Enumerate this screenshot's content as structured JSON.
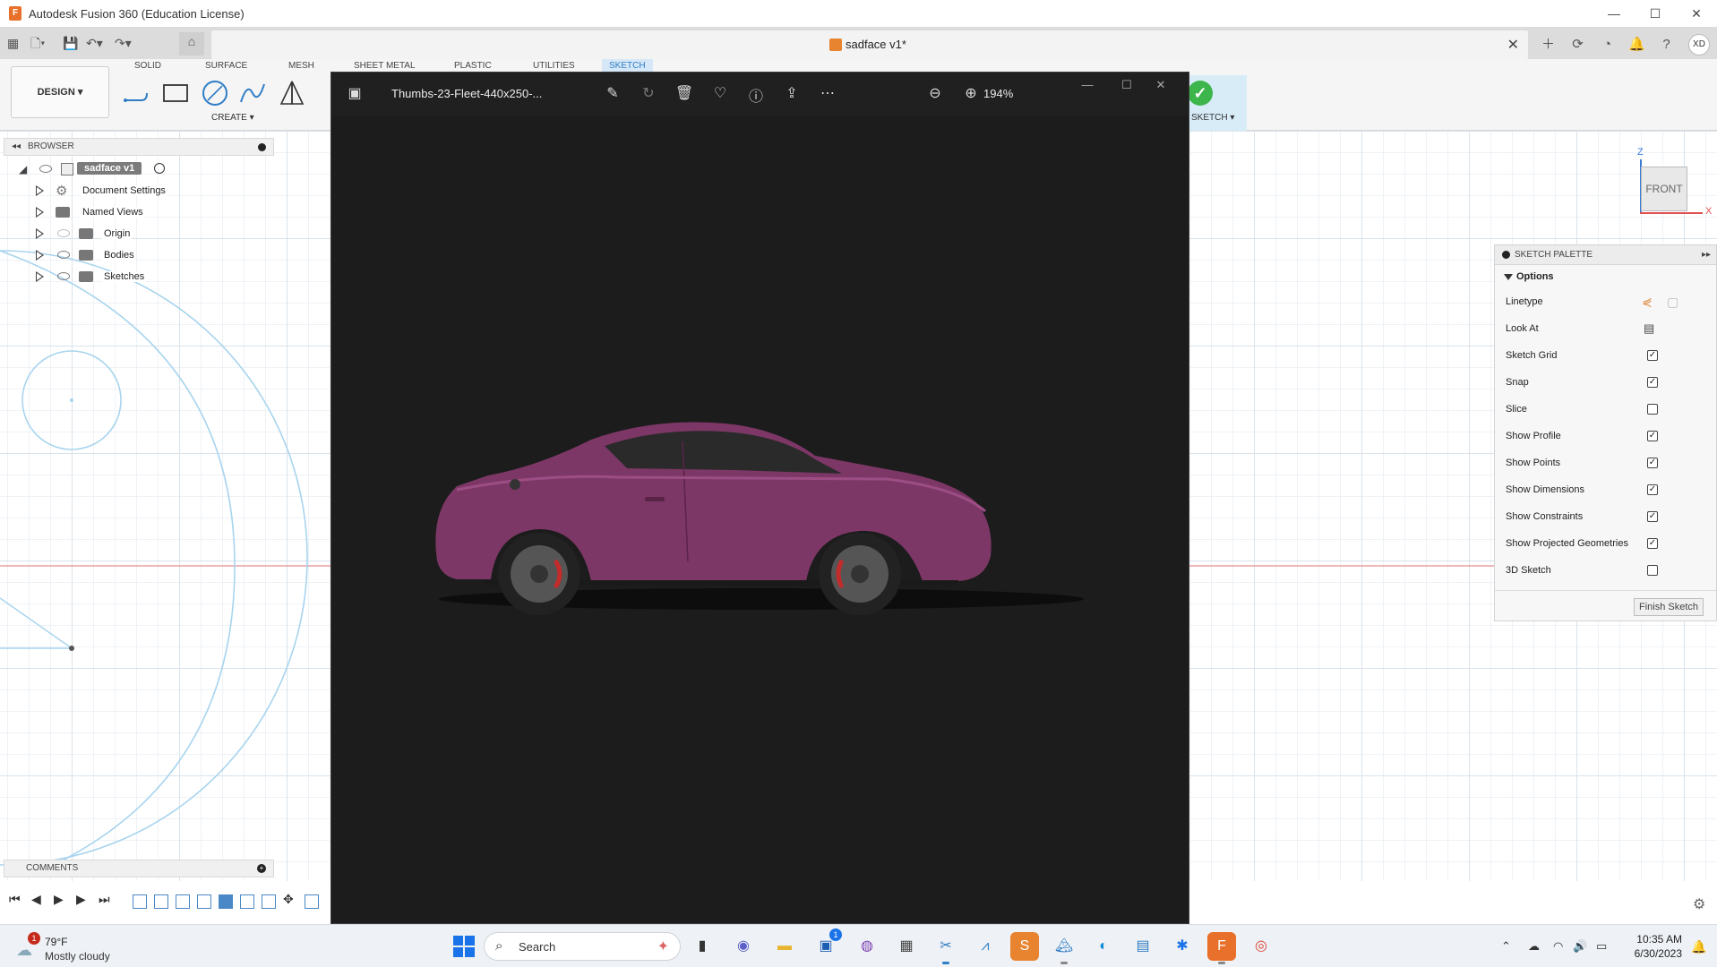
{
  "window": {
    "title": "Autodesk Fusion 360 (Education License)",
    "logo_letter": "F",
    "minimize": "—",
    "maximize": "☐",
    "close": "✕"
  },
  "document": {
    "name": "sadface v1*",
    "close": "✕"
  },
  "user": {
    "initials": "XD"
  },
  "ribbon": {
    "tabs": [
      "SOLID",
      "SURFACE",
      "MESH",
      "SHEET METAL",
      "PLASTIC",
      "UTILITIES",
      "SKETCH"
    ],
    "design_button": "DESIGN ▾",
    "create_label": "CREATE ▾",
    "finish_sketch_label": "SKETCH ▾"
  },
  "browser": {
    "header": "BROWSER",
    "items": [
      {
        "label": "sadface v1"
      },
      {
        "label": "Document Settings"
      },
      {
        "label": "Named Views"
      },
      {
        "label": "Origin"
      },
      {
        "label": "Bodies"
      },
      {
        "label": "Sketches"
      }
    ]
  },
  "comments": {
    "header": "COMMENTS"
  },
  "viewcube": {
    "face": "FRONT",
    "axis_z": "Z",
    "axis_x": "X"
  },
  "sketch_palette": {
    "header": "SKETCH PALETTE",
    "section": "Options",
    "options": [
      {
        "label": "Linetype",
        "type": "icons"
      },
      {
        "label": "Look At",
        "type": "icon"
      },
      {
        "label": "Sketch Grid",
        "checked": true
      },
      {
        "label": "Snap",
        "checked": true
      },
      {
        "label": "Slice",
        "checked": false
      },
      {
        "label": "Show Profile",
        "checked": true
      },
      {
        "label": "Show Points",
        "checked": true
      },
      {
        "label": "Show Dimensions",
        "checked": true
      },
      {
        "label": "Show Constraints",
        "checked": true
      },
      {
        "label": "Show Projected Geometries",
        "checked": true
      },
      {
        "label": "3D Sketch",
        "checked": false
      }
    ],
    "finish_button": "Finish Sketch"
  },
  "photos": {
    "filename": "Thumbs-23-Fleet-440x250-...",
    "zoom": "194%",
    "car_color": "#7d3766"
  },
  "taskbar": {
    "weather": {
      "badge": "1",
      "temp": "79°F",
      "condition": "Mostly cloudy"
    },
    "search_label": "Search",
    "teams_badge": "1",
    "time": "10:35 AM",
    "date": "6/30/2023"
  },
  "colors": {
    "accent": "#2f7dc5",
    "grid_major": "#d9e3ec",
    "sketch_line": "#a8d4ee",
    "axis_red": "#e07070",
    "photos_bg": "#1c1c1c"
  }
}
